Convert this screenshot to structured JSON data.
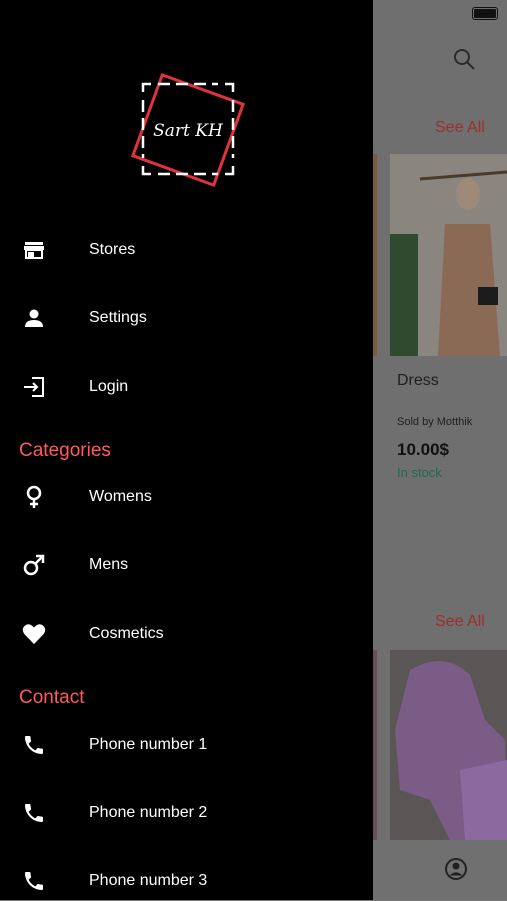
{
  "background": {
    "see_all_1": "See All",
    "see_all_2": "See All",
    "product": {
      "title": "Dress",
      "seller": "Sold by Motthik",
      "price": "10.00$",
      "stock": "In stock"
    }
  },
  "drawer": {
    "logo_text": "Sart KH",
    "menu": {
      "stores": "Stores",
      "settings": "Settings",
      "login": "Login"
    },
    "categories": {
      "title": "Categories",
      "womens": "Womens",
      "mens": "Mens",
      "cosmetics": "Cosmetics"
    },
    "contact": {
      "title": "Contact",
      "phone1": "Phone number 1",
      "phone2": "Phone number 2",
      "phone3": "Phone number 3"
    }
  },
  "colors": {
    "accent": "#ff5a5f",
    "drawer_bg": "#000000",
    "stock_green": "#1f6b52"
  }
}
